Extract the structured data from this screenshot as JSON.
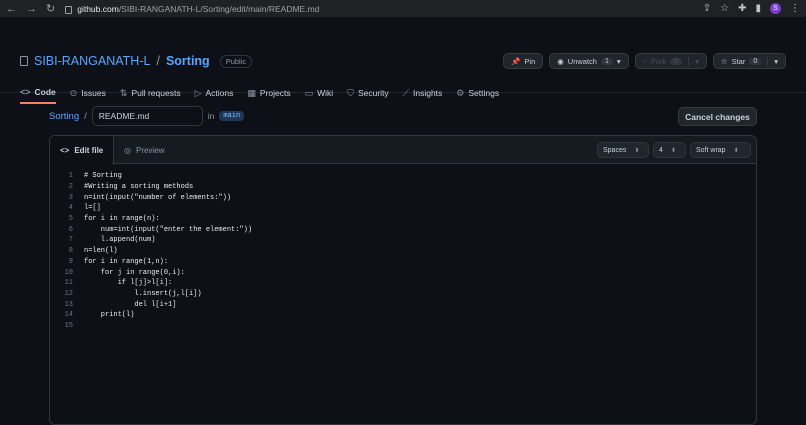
{
  "browser": {
    "url_host": "github.com",
    "url_path": "/SIBI-RANGANATH-L/Sorting/edit/main/README.md",
    "profile_initial": "S"
  },
  "repo": {
    "owner": "SIBI-RANGANATH-L",
    "separator": "/",
    "name": "Sorting",
    "visibility": "Public"
  },
  "actions": {
    "pin": "Pin",
    "unwatch": "Unwatch",
    "watch_count": "1",
    "fork": "Fork",
    "fork_count": "0",
    "star": "Star",
    "star_count": "0"
  },
  "tabs": [
    {
      "label": "Code",
      "icon": "code-icon"
    },
    {
      "label": "Issues",
      "icon": "issue-icon"
    },
    {
      "label": "Pull requests",
      "icon": "pull-request-icon"
    },
    {
      "label": "Actions",
      "icon": "play-icon"
    },
    {
      "label": "Projects",
      "icon": "table-icon"
    },
    {
      "label": "Wiki",
      "icon": "book-icon"
    },
    {
      "label": "Security",
      "icon": "shield-icon"
    },
    {
      "label": "Insights",
      "icon": "graph-icon"
    },
    {
      "label": "Settings",
      "icon": "gear-icon"
    }
  ],
  "editor": {
    "path_repo": "Sorting",
    "path_sep": "/",
    "filename": "README.md",
    "in_label": "in",
    "branch": "main",
    "cancel_label": "Cancel changes",
    "tab_edit": "Edit file",
    "tab_preview": "Preview",
    "indent_mode": "Spaces",
    "indent_size": "4",
    "wrap_mode": "Soft wrap"
  },
  "code_lines": [
    "# Sorting",
    "#Writing a sorting methods",
    "n=int(input(\"number of elements:\"))",
    "l=[]",
    "for i in range(n):",
    "    num=int(input(\"enter the element:\"))",
    "    l.append(num)",
    "n=len(l)",
    "for i in range(1,n):",
    "    for j in range(0,i):",
    "        if l[j]>l[i]:",
    "            l.insert(j,l[i])",
    "            del l[i+1]",
    "    print(l)",
    ""
  ],
  "colors": {
    "accent_link": "#58a6ff",
    "tab_underline": "#f78166",
    "background": "#0d1117"
  }
}
